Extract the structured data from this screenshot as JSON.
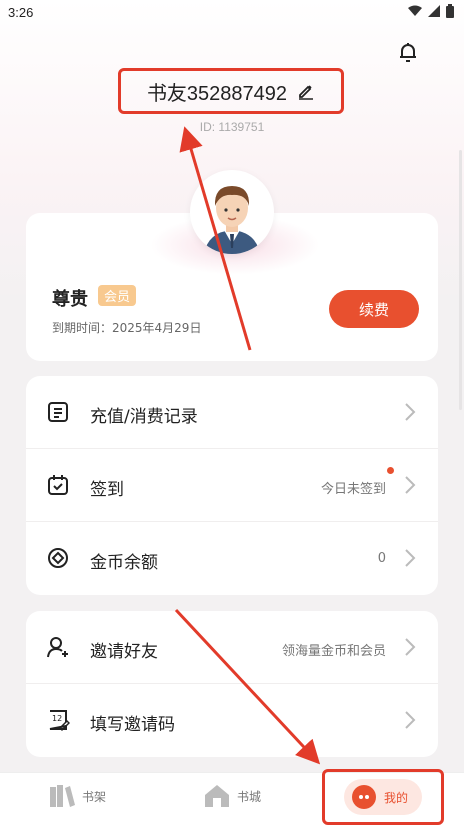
{
  "status_bar": {
    "time": "3:26"
  },
  "profile": {
    "username": "书友352887492",
    "user_id": "ID: 1139751"
  },
  "vip": {
    "title": "尊贵",
    "badge": "会员",
    "expiry": "到期时间：2025年4月29日",
    "renew_button": "续费"
  },
  "menu1": [
    {
      "label": "充值/消费记录",
      "value": ""
    },
    {
      "label": "签到",
      "value": "今日未签到"
    },
    {
      "label": "金币余额",
      "value": "0"
    }
  ],
  "menu2": [
    {
      "label": "邀请好友",
      "value": "领海量金币和会员"
    },
    {
      "label": "填写邀请码",
      "value": ""
    }
  ],
  "bottom_nav": {
    "shelf": "书架",
    "city": "书城",
    "mine": "我的"
  },
  "colors": {
    "accent": "#e8502f",
    "annotation": "#e23b2a",
    "badge": "#f8c98f"
  },
  "icons": [
    "bell-icon",
    "edit-icon",
    "record-icon",
    "calendar-check-icon",
    "coin-icon",
    "add-user-icon",
    "invite-code-icon",
    "chevron-right-icon",
    "bookshelf-icon",
    "home-icon"
  ]
}
